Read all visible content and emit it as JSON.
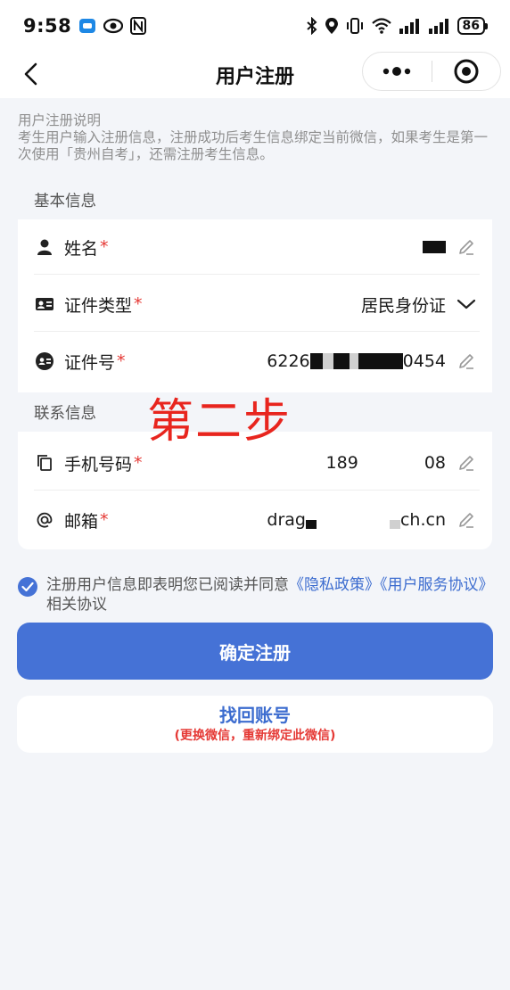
{
  "status_bar": {
    "time": "9:58",
    "battery": "86",
    "left_icons": [
      "message-icon",
      "eye-icon",
      "nfc-icon"
    ],
    "right_icons": [
      "bluetooth-icon",
      "location-icon",
      "vibrate-icon",
      "wifi-icon",
      "signal-icon",
      "signal-icon"
    ]
  },
  "nav": {
    "title": "用户注册",
    "more_icon": "more-dots-icon",
    "close_icon": "target-icon"
  },
  "notice": {
    "title": "用户注册说明",
    "body": "考生用户输入注册信息，注册成功后考生信息绑定当前微信，如果考生是第一次使用「贵州自考」，还需注册考生信息。"
  },
  "form": {
    "basic_section": "基本信息",
    "contact_section": "联系信息",
    "required_mark": "*",
    "fields": {
      "name": {
        "label": "姓名",
        "value": ""
      },
      "id_type": {
        "label": "证件类型",
        "value": "居民身份证"
      },
      "id_number": {
        "label": "证件号",
        "value_prefix": "6226",
        "value_suffix": "0454"
      },
      "phone": {
        "label": "手机号码",
        "value_prefix": "189",
        "value_suffix": "08"
      },
      "email": {
        "label": "邮箱",
        "value_prefix": "drag",
        "value_suffix": "ch.cn"
      }
    }
  },
  "annotation": {
    "step": "第二步"
  },
  "agreement": {
    "text": "注册用户信息即表明您已阅读并同意",
    "privacy_link": "《隐私政策》",
    "service_link": "《用户服务协议》",
    "suffix": "相关协议",
    "checked": true
  },
  "buttons": {
    "register": "确定注册",
    "recover": "找回账号",
    "recover_sub": "(更换微信，重新绑定此微信)"
  },
  "colors": {
    "primary": "#4572d6",
    "link": "#3c6ccf",
    "required": "#e53935",
    "annotation": "#e8251e"
  }
}
